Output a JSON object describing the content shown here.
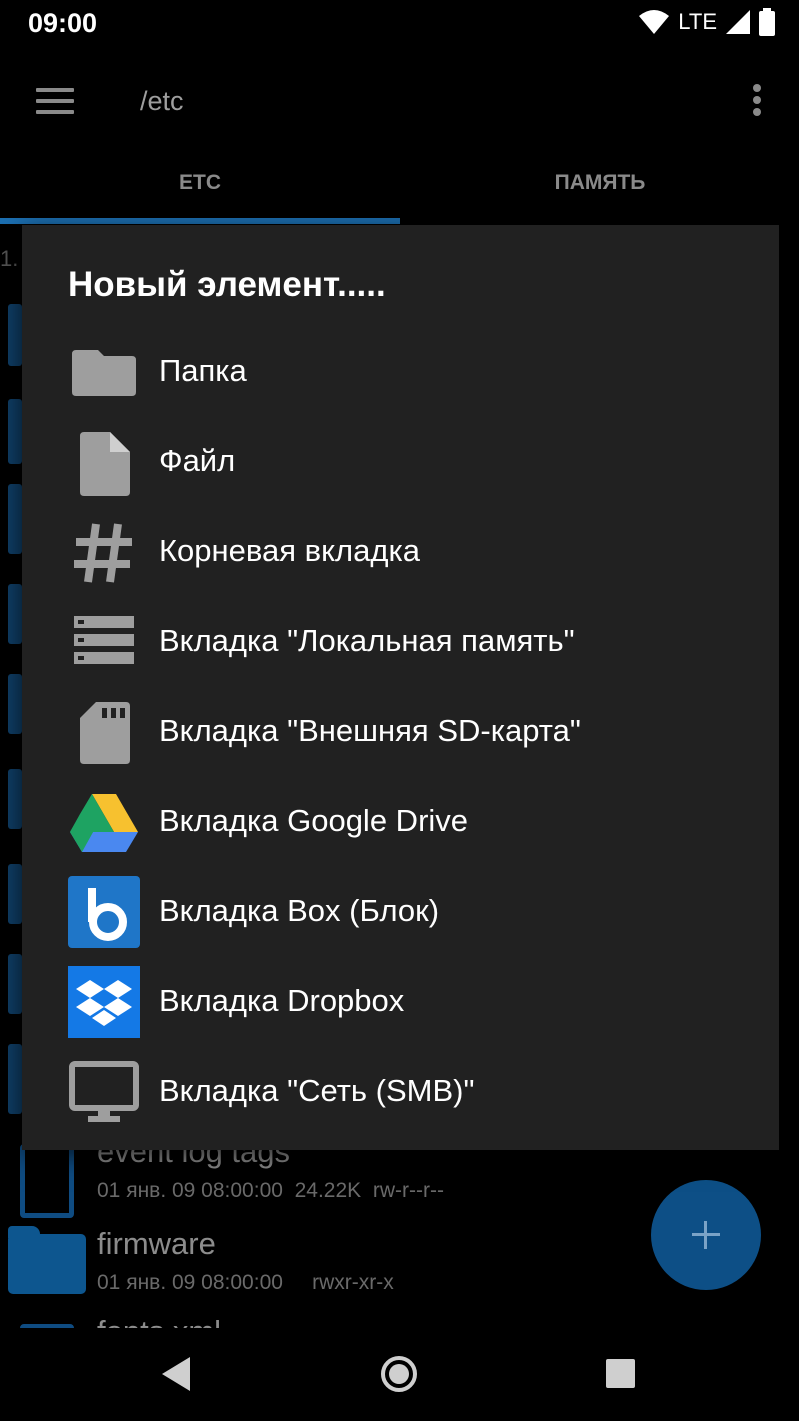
{
  "status_bar": {
    "time": "09:00",
    "network": "LTE",
    "icons": [
      "wifi-icon",
      "signal-icon",
      "battery-icon"
    ]
  },
  "app_bar": {
    "path": "/etc",
    "menu_icon": "hamburger-menu-icon",
    "overflow_icon": "more-vert-icon"
  },
  "tabs": [
    {
      "label": "ETC",
      "active": true
    },
    {
      "label": "ПАМЯТЬ",
      "active": false
    }
  ],
  "background_list": {
    "partial_number": "1.",
    "rows": [
      {
        "name": "event log tags",
        "meta": "01 янв. 09 08:00:00  24.22K  rw-r--r--",
        "type": "file"
      },
      {
        "name": "firmware",
        "meta": "01 янв. 09 08:00:00     rwxr-xr-x",
        "type": "folder"
      },
      {
        "name": "fonts.xml",
        "meta": "",
        "type": "file"
      }
    ]
  },
  "dialog": {
    "title": "Новый элемент.....",
    "items": [
      {
        "label": "Папка",
        "icon": "folder-icon"
      },
      {
        "label": "Файл",
        "icon": "file-icon"
      },
      {
        "label": "Корневая вкладка",
        "icon": "hash-icon"
      },
      {
        "label": "Вкладка \"Локальная память\"",
        "icon": "storage-icon"
      },
      {
        "label": "Вкладка \"Внешняя SD-карта\"",
        "icon": "sd-card-icon"
      },
      {
        "label": "Вкладка Google Drive",
        "icon": "google-drive-icon"
      },
      {
        "label": "Вкладка Box (Блок)",
        "icon": "box-icon"
      },
      {
        "label": "Вкладка Dropbox",
        "icon": "dropbox-icon"
      },
      {
        "label": "Вкладка \"Сеть (SMB)\"",
        "icon": "monitor-icon"
      }
    ]
  },
  "fab": {
    "icon": "add-icon"
  },
  "nav_bar": {
    "icons": [
      "back-icon",
      "home-icon",
      "recents-icon"
    ]
  },
  "colors": {
    "accent": "#1c6fb1",
    "dialog_bg": "#212121",
    "icon_grey": "#9e9e9e"
  }
}
